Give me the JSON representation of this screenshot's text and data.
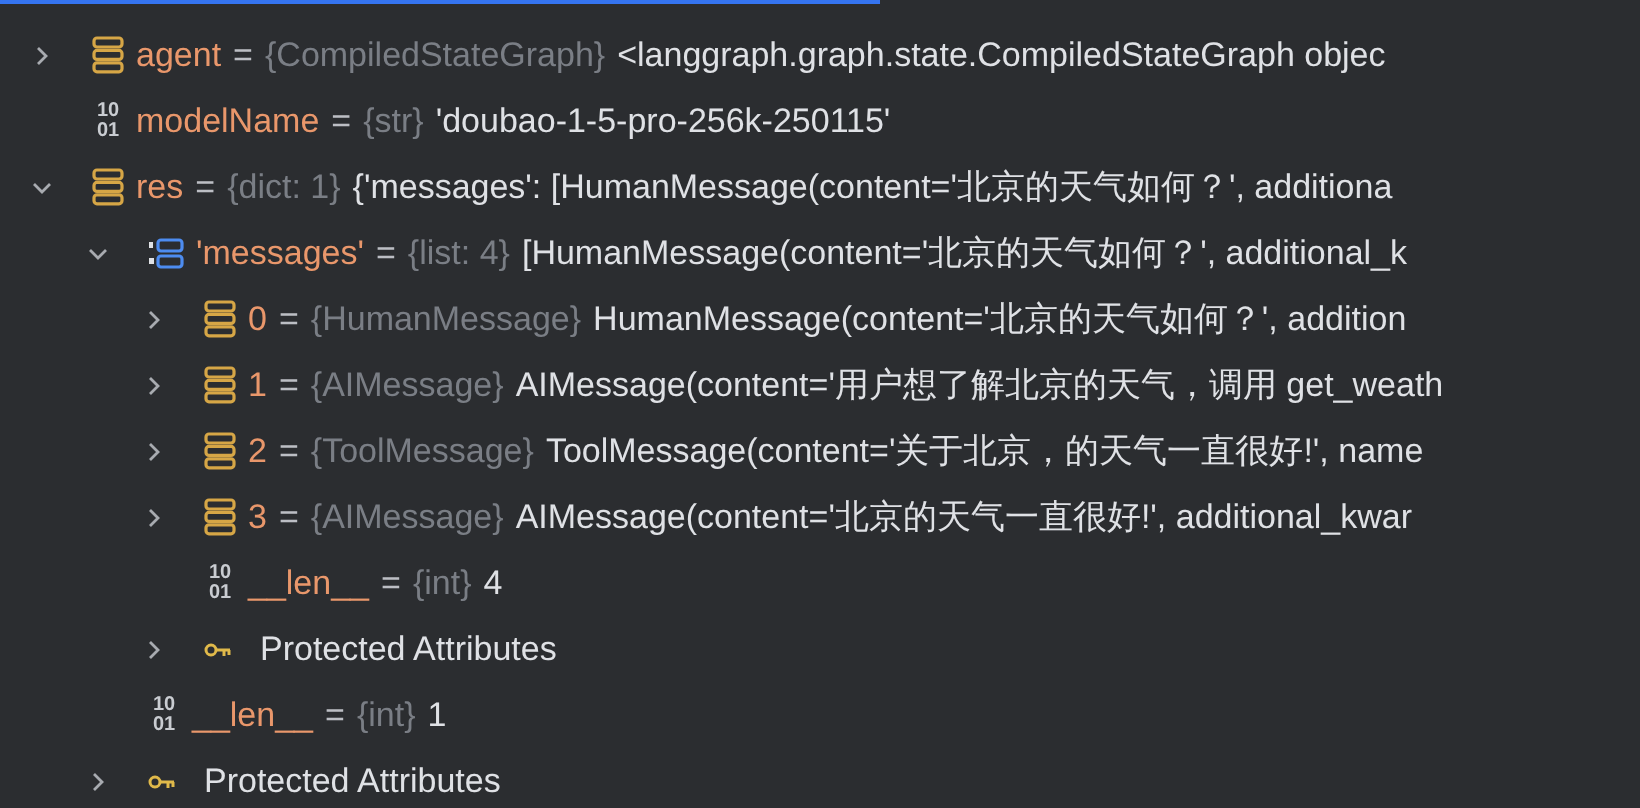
{
  "variables": [
    {
      "kind": "object",
      "name": "agent",
      "separator": "=",
      "type": "{CompiledStateGraph}",
      "value": "<langgraph.graph.state.CompiledStateGraph objec",
      "expanded": false
    },
    {
      "kind": "primitive",
      "icon_label": [
        "10",
        "01"
      ],
      "name": "modelName",
      "separator": "=",
      "type": "{str}",
      "value": "'doubao-1-5-pro-256k-250115'"
    },
    {
      "kind": "object",
      "name": "res",
      "separator": "=",
      "type": "{dict: 1}",
      "value": "{'messages': [HumanMessage(content='北京的天气如何？', additiona",
      "expanded": true,
      "children": [
        {
          "kind": "list",
          "name": "'messages'",
          "separator": "=",
          "type": "{list: 4}",
          "value": "[HumanMessage(content='北京的天气如何？', additional_k",
          "expanded": true,
          "children": [
            {
              "kind": "object",
              "name": "0",
              "separator": "=",
              "type": "{HumanMessage}",
              "value": "HumanMessage(content='北京的天气如何？', addition",
              "expanded": false
            },
            {
              "kind": "object",
              "name": "1",
              "separator": "=",
              "type": "{AIMessage}",
              "value": "AIMessage(content='用户想了解北京的天气，调用 get_weath",
              "expanded": false
            },
            {
              "kind": "object",
              "name": "2",
              "separator": "=",
              "type": "{ToolMessage}",
              "value": "ToolMessage(content='关于北京，的天气一直很好!', name",
              "expanded": false
            },
            {
              "kind": "object",
              "name": "3",
              "separator": "=",
              "type": "{AIMessage}",
              "value": "AIMessage(content='北京的天气一直很好!', additional_kwar",
              "expanded": false
            },
            {
              "kind": "primitive",
              "icon_label": [
                "10",
                "01"
              ],
              "name": "__len__",
              "separator": "=",
              "type": "{int}",
              "value": "4"
            },
            {
              "kind": "protected",
              "name": "Protected Attributes",
              "expanded": false
            }
          ]
        },
        {
          "kind": "primitive",
          "icon_label": [
            "10",
            "01"
          ],
          "name": "__len__",
          "separator": "=",
          "type": "{int}",
          "value": "1"
        },
        {
          "kind": "protected",
          "name": "Protected Attributes",
          "expanded": false
        }
      ]
    }
  ]
}
